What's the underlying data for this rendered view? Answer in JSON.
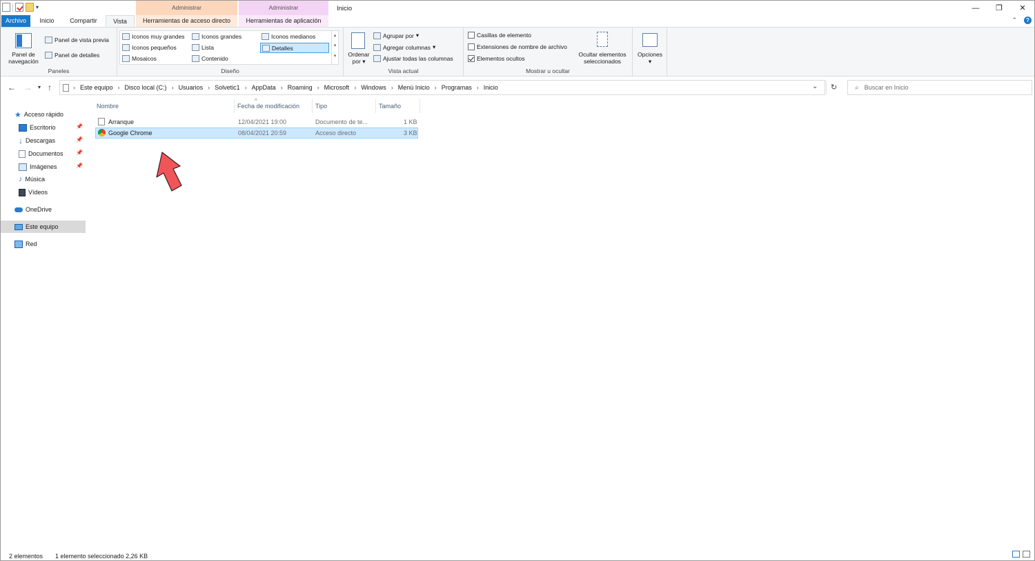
{
  "titlebar": {
    "context_tab_1": "Administrar",
    "context_tab_2": "Administrar",
    "window_title": "Inicio"
  },
  "tabs": {
    "archivo": "Archivo",
    "inicio": "Inicio",
    "compartir": "Compartir",
    "vista": "Vista",
    "acceso_directo": "Herramientas de acceso directo",
    "aplicacion": "Herramientas de aplicación"
  },
  "ribbon": {
    "panel_navegacion": "Panel de navegación",
    "panel_vista_previa": "Panel de vista previa",
    "panel_detalles": "Panel de detalles",
    "paneles_label": "Paneles",
    "layout": {
      "muy_grandes": "Iconos muy grandes",
      "grandes": "Iconos grandes",
      "medianos": "Iconos medianos",
      "pequenos": "Iconos pequeños",
      "lista": "Lista",
      "detalles": "Detalles",
      "mosaicos": "Mosaicos",
      "contenido": "Contenido"
    },
    "diseno_label": "Diseño",
    "ordenar_por": "Ordenar por",
    "agrupar_por": "Agrupar por",
    "agregar_columnas": "Agregar columnas",
    "ajustar_columnas": "Ajustar todas las columnas",
    "vista_actual_label": "Vista actual",
    "casillas": "Casillas de elemento",
    "extensiones": "Extensiones de nombre de archivo",
    "ocultos": "Elementos ocultos",
    "casillas_checked": false,
    "extensiones_checked": false,
    "ocultos_checked": true,
    "ocultar_seleccionados": "Ocultar elementos seleccionados",
    "mostrar_label": "Mostrar u ocultar",
    "opciones": "Opciones"
  },
  "address": {
    "crumbs": [
      "Este equipo",
      "Disco local (C:)",
      "Usuarios",
      "Solvetic1",
      "AppData",
      "Roaming",
      "Microsoft",
      "Windows",
      "Menú Inicio",
      "Programas",
      "Inicio"
    ],
    "search_placeholder": "Buscar en Inicio"
  },
  "navpane": {
    "acceso_rapido": "Acceso rápido",
    "escritorio": "Escritorio",
    "descargas": "Descargas",
    "documentos": "Documentos",
    "imagenes": "Imágenes",
    "musica": "Música",
    "videos": "Vídeos",
    "onedrive": "OneDrive",
    "este_equipo": "Este equipo",
    "red": "Red"
  },
  "columns": {
    "nombre": "Nombre",
    "fecha": "Fecha de modificación",
    "tipo": "Tipo",
    "tamano": "Tamaño"
  },
  "files": [
    {
      "name": "Arranque",
      "date": "12/04/2021 19:00",
      "type": "Documento de te...",
      "size": "1 KB"
    },
    {
      "name": "Google Chrome",
      "date": "08/04/2021 20:59",
      "type": "Acceso directo",
      "size": "3 KB"
    }
  ],
  "status": {
    "count": "2 elementos",
    "selected": "1 elemento seleccionado 2,26 KB"
  },
  "colors": {
    "accent": "#1979ca",
    "selection": "#cce8ff",
    "arrow": "#f0555a"
  }
}
